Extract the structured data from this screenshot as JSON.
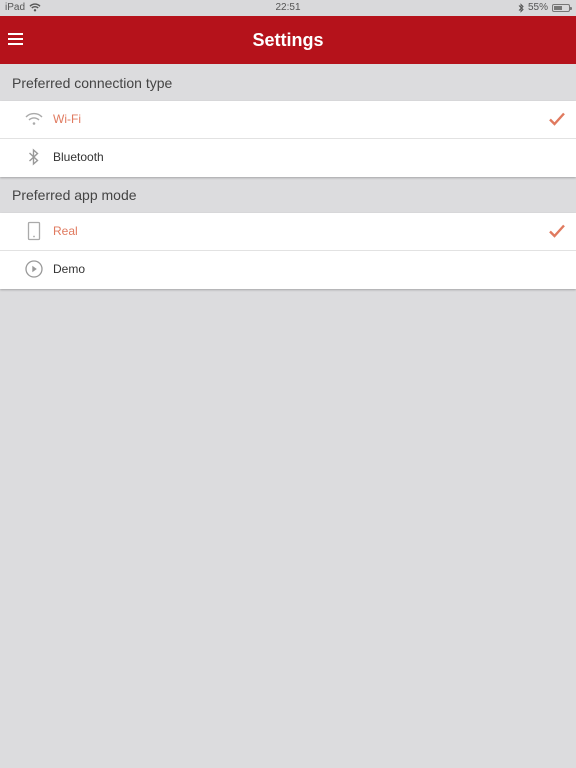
{
  "status_bar": {
    "device": "iPad",
    "time": "22:51",
    "battery": "55%",
    "battery_level": 0.55
  },
  "navbar": {
    "title": "Settings",
    "menu_icon": "hamburger-icon"
  },
  "connection": {
    "header": "Preferred connection type",
    "items": [
      {
        "label": "Wi-Fi",
        "icon": "wifi-icon",
        "selected": true
      },
      {
        "label": "Bluetooth",
        "icon": "bluetooth-icon",
        "selected": false
      }
    ]
  },
  "app_mode": {
    "header": "Preferred app mode",
    "items": [
      {
        "label": "Real",
        "icon": "phone-icon",
        "selected": true
      },
      {
        "label": "Demo",
        "icon": "play-circle-icon",
        "selected": false
      }
    ]
  },
  "colors": {
    "brand": "#b5121b",
    "accent": "#e07a5f",
    "background": "#dcdcde"
  }
}
